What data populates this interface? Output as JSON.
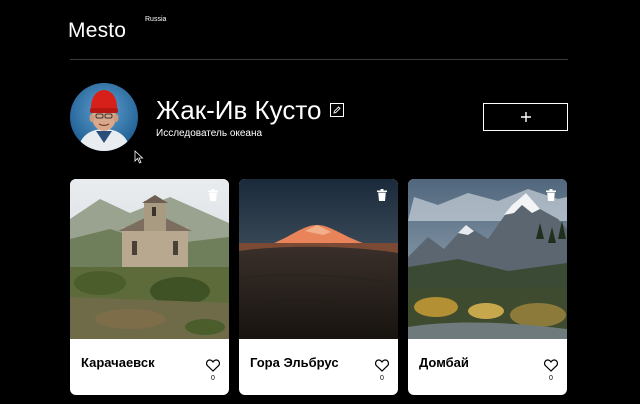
{
  "header": {
    "logo": "Mesto",
    "logo_sup": "Russia"
  },
  "profile": {
    "name": "Жак-Ив Кусто",
    "about": "Исследователь океана",
    "add_label": "+"
  },
  "icons": {
    "edit": "pencil-icon",
    "add": "plus-icon",
    "trash": "trash-icon",
    "like": "heart-icon"
  },
  "cards": [
    {
      "title": "Карачаевск",
      "likes": "0"
    },
    {
      "title": "Гора Эльбрус",
      "likes": "0"
    },
    {
      "title": "Домбай",
      "likes": "0"
    }
  ]
}
